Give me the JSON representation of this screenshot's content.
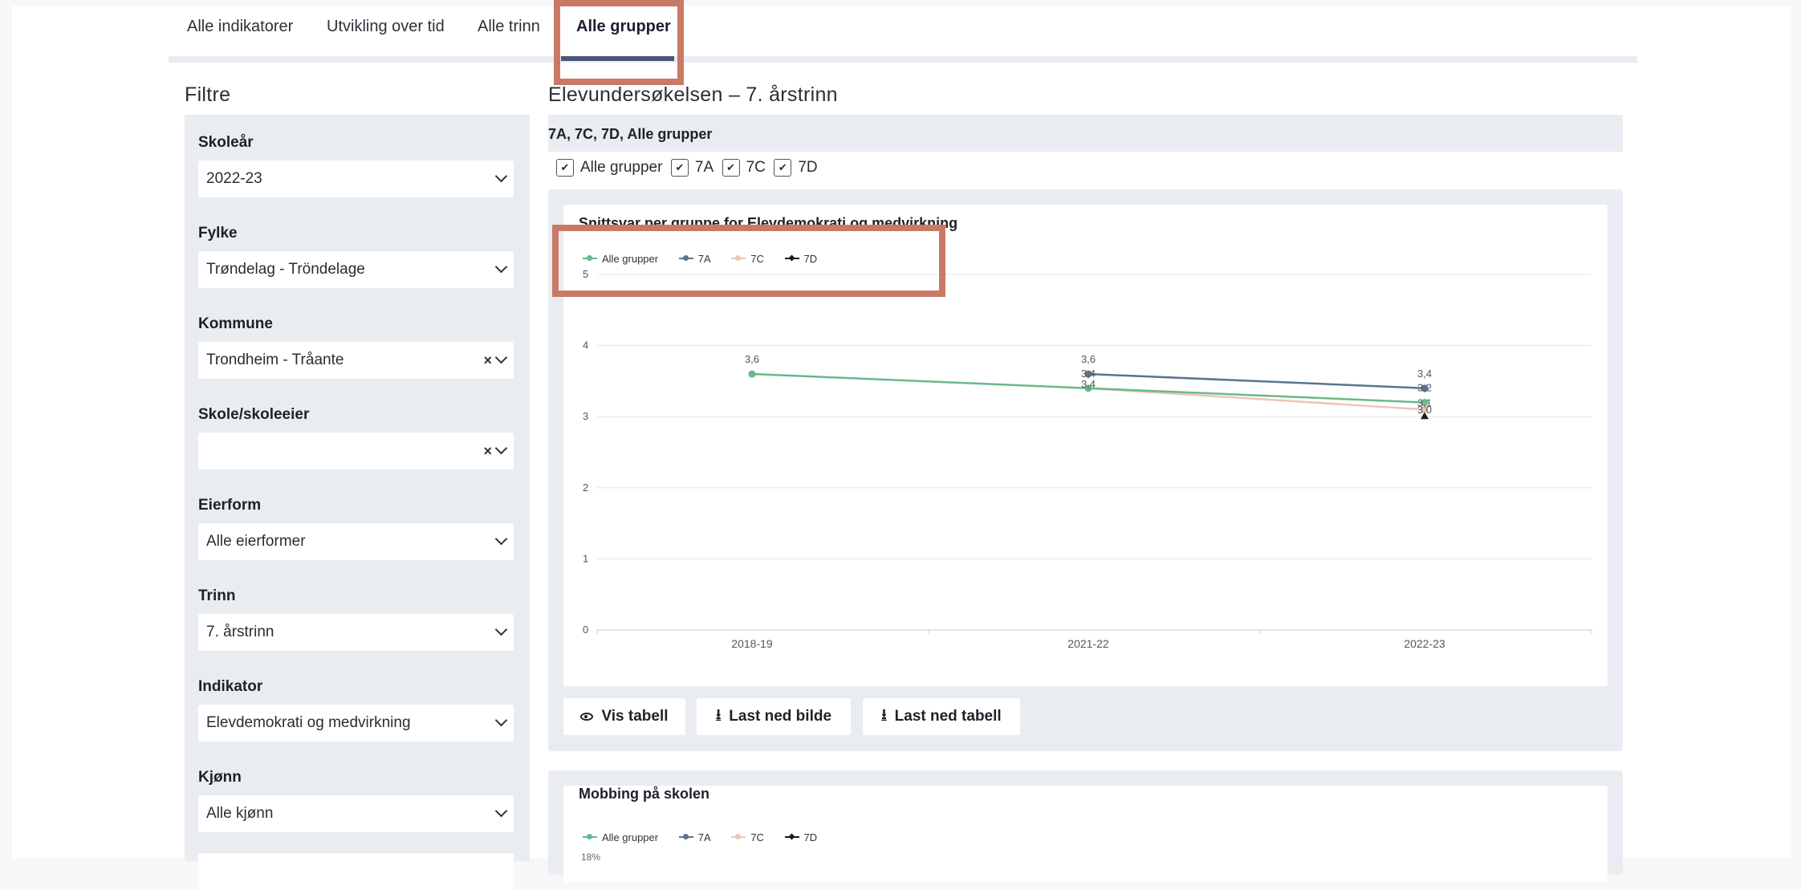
{
  "tabs": [
    {
      "label": "Alle indikatorer"
    },
    {
      "label": "Utvikling over tid"
    },
    {
      "label": "Alle trinn"
    },
    {
      "label": "Alle grupper"
    }
  ],
  "filters": {
    "title": "Filtre",
    "skolear": {
      "label": "Skoleår",
      "value": "2022-23"
    },
    "fylke": {
      "label": "Fylke",
      "value": "Trøndelag - Tröndelage"
    },
    "kommune": {
      "label": "Kommune",
      "value": "Trondheim - Tråante"
    },
    "skole": {
      "label": "Skole/skoleeier",
      "value": ""
    },
    "eierform": {
      "label": "Eierform",
      "value": "Alle eierformer"
    },
    "trinn": {
      "label": "Trinn",
      "value": "7. årstrinn"
    },
    "indikator": {
      "label": "Indikator",
      "value": "Elevdemokrati og medvirkning"
    },
    "kjonn": {
      "label": "Kjønn",
      "value": "Alle kjønn"
    }
  },
  "main": {
    "title": "Elevundersøkelsen – 7. årstrinn",
    "group_bar": "7A, 7C, 7D, Alle grupper",
    "checkboxes": [
      "Alle grupper",
      "7A",
      "7C",
      "7D"
    ],
    "buttons": {
      "show_table": "Vis tabell",
      "download_image": "Last ned bilde",
      "download_table": "Last ned tabell"
    }
  },
  "colors": {
    "alle_grupper": "#6ab88a",
    "7A": "#5b7391",
    "7C": "#f0c4b8",
    "7D": "#1a1a1a",
    "highlight": "#c97a66"
  },
  "chart_data": [
    {
      "type": "line",
      "title": "Snittsvar per gruppe for Elevdemokrati og medvirkning",
      "categories": [
        "2018-19",
        "2021-22",
        "2022-23"
      ],
      "ylim": [
        0,
        5
      ],
      "yticks": [
        0,
        1,
        2,
        3,
        4,
        5
      ],
      "grid": true,
      "legend": "top-left",
      "series": [
        {
          "name": "Alle grupper",
          "values": [
            3.6,
            3.4,
            3.2
          ],
          "labels": [
            "3,6",
            "3,4",
            "3,2"
          ]
        },
        {
          "name": "7A",
          "values": [
            null,
            3.6,
            3.4
          ],
          "labels": [
            null,
            "3,6",
            "3,4"
          ]
        },
        {
          "name": "7C",
          "values": [
            null,
            3.4,
            3.1
          ],
          "labels": [
            null,
            "3,4",
            "3,1"
          ]
        },
        {
          "name": "7D",
          "values": [
            null,
            null,
            3.0
          ],
          "labels": [
            null,
            null,
            "3,0"
          ]
        }
      ]
    },
    {
      "type": "line",
      "title": "Mobbing på skolen",
      "legend": "top-left",
      "series": [
        {
          "name": "Alle grupper"
        },
        {
          "name": "7A"
        },
        {
          "name": "7C"
        },
        {
          "name": "7D"
        }
      ],
      "yticks_visible": [
        "18%"
      ]
    }
  ]
}
